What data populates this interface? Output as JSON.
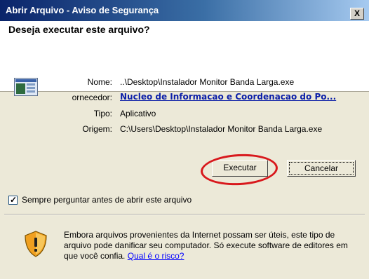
{
  "window": {
    "title": "Abrir Arquivo - Aviso de Segurança",
    "close_label": "X"
  },
  "dialog": {
    "question": "Deseja executar este arquivo?",
    "fields": {
      "name_label": "Nome:",
      "name_value": "..\\Desktop\\Instalador Monitor Banda Larga.exe",
      "publisher_label": "ornecedor:",
      "publisher_value": "Nucleo de Informacao e Coordenacao do Po...",
      "type_label": "Tipo:",
      "type_value": "Aplicativo",
      "origin_label": "Origem:",
      "origin_value": "C:\\Users\\Desktop\\Instalador Monitor Banda Larga.exe"
    },
    "buttons": {
      "run": "Executar",
      "cancel": "Cancelar"
    },
    "checkbox": {
      "label": "Sempre perguntar antes de abrir este arquivo",
      "checked": true
    },
    "warning": {
      "text": "Embora arquivos provenientes da Internet possam ser úteis, este tipo de arquivo pode danificar seu computador. Só execute software de editores em que você confia.",
      "link": "Qual é o risco?"
    }
  },
  "icons": [
    "file-icon",
    "shield-warning-icon",
    "close-icon",
    "check-icon"
  ],
  "colors": {
    "title_bar": "#0a246a",
    "link": "#0c1fa8",
    "highlight_ellipse": "#d8181c",
    "shield": "#f0a020"
  }
}
